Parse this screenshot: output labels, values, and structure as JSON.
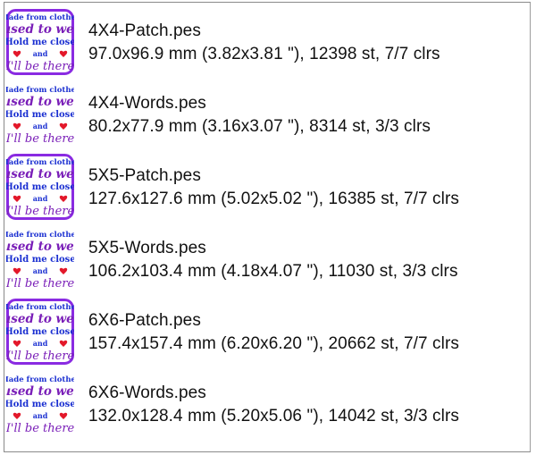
{
  "thumbnail_text": {
    "line1": "Made from clothes",
    "line2": "I used to wear",
    "line3": "Hold me close",
    "line4": "and",
    "line5": "I'll be there"
  },
  "colors": {
    "patch_border": "#8a2be2",
    "blue_text": "#1a2fd1",
    "purple_text": "#7a1fb8",
    "heart_red": "#e3182a"
  },
  "files": [
    {
      "name": "4X4-Patch.pes",
      "info": "97.0x96.9 mm (3.82x3.81 \"), 12398 st, 7/7 clrs",
      "type": "patch"
    },
    {
      "name": "4X4-Words.pes",
      "info": "80.2x77.9 mm (3.16x3.07 \"), 8314 st, 3/3 clrs",
      "type": "words"
    },
    {
      "name": "5X5-Patch.pes",
      "info": "127.6x127.6 mm (5.02x5.02 \"), 16385 st, 7/7 clrs",
      "type": "patch"
    },
    {
      "name": "5X5-Words.pes",
      "info": "106.2x103.4 mm (4.18x4.07 \"), 11030 st, 3/3 clrs",
      "type": "words"
    },
    {
      "name": "6X6-Patch.pes",
      "info": "157.4x157.4 mm (6.20x6.20 \"), 20662 st, 7/7 clrs",
      "type": "patch"
    },
    {
      "name": "6X6-Words.pes",
      "info": "132.0x128.4 mm (5.20x5.06 \"), 14042 st, 3/3 clrs",
      "type": "words"
    }
  ]
}
